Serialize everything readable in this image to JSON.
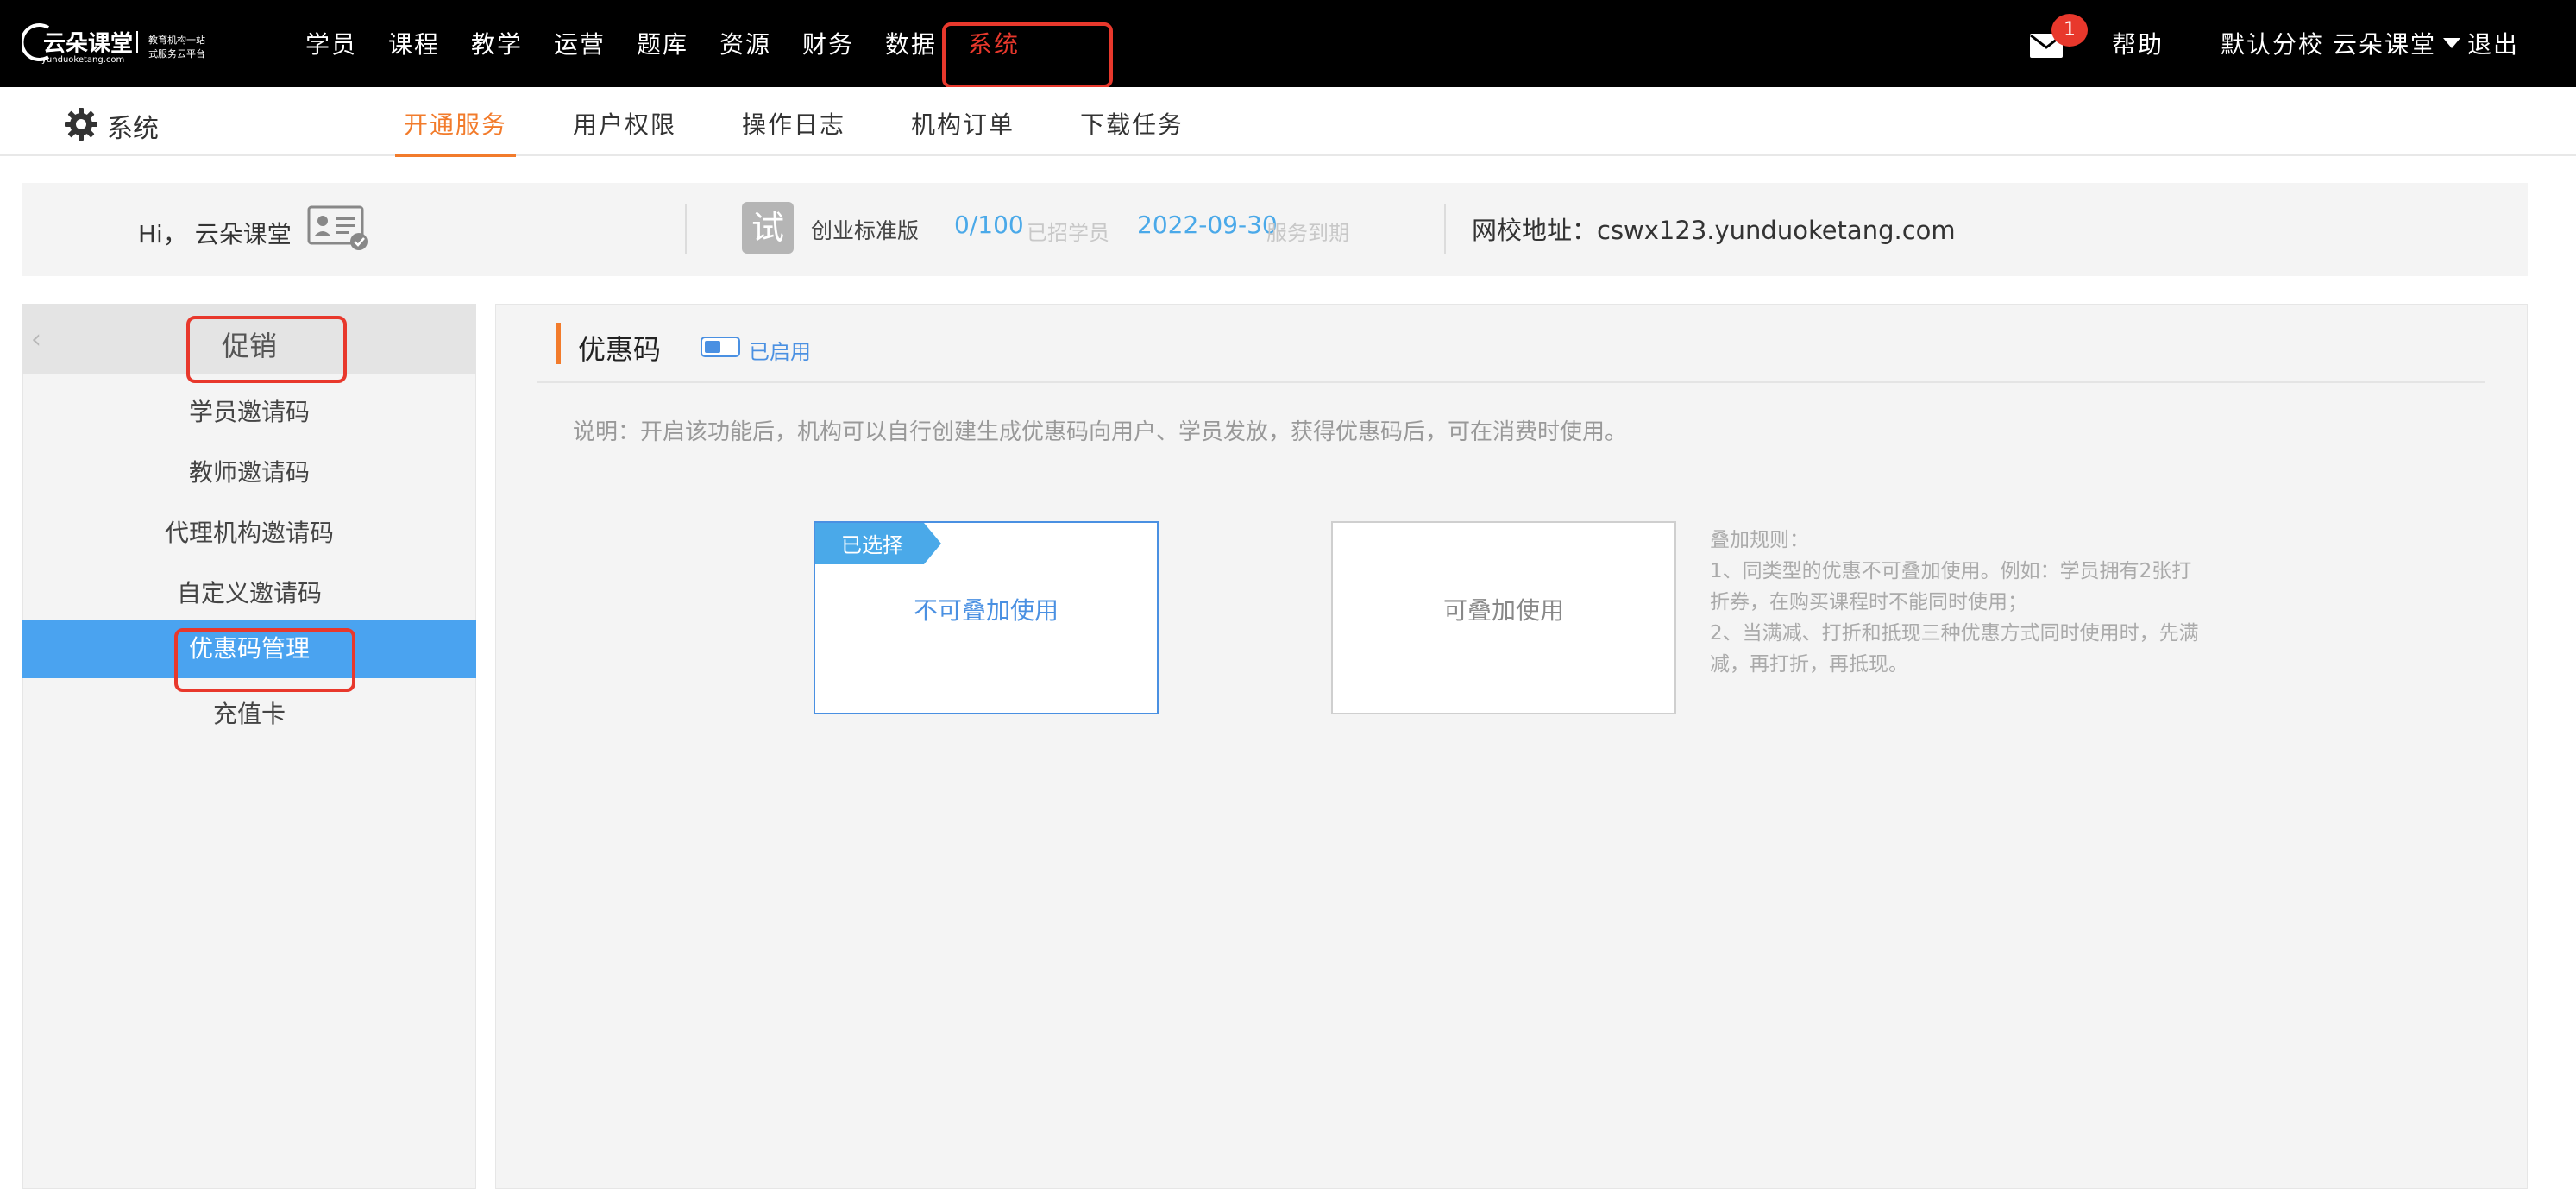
{
  "logo": {
    "main": "云朵课堂",
    "sub": "yunduoketang.com",
    "tag_line1": "教育机构一站",
    "tag_line2": "式服务云平台"
  },
  "top_nav": {
    "items": [
      {
        "label": "学员"
      },
      {
        "label": "课程"
      },
      {
        "label": "教学"
      },
      {
        "label": "运营"
      },
      {
        "label": "题库"
      },
      {
        "label": "资源"
      },
      {
        "label": "财务"
      },
      {
        "label": "数据"
      },
      {
        "label": "系统"
      }
    ],
    "active_index": 8,
    "message_count": "1",
    "help": "帮助",
    "branch": "默认分校",
    "user": "云朵课堂",
    "logout": "退出"
  },
  "sub_nav": {
    "title": "系统",
    "tabs": [
      {
        "label": "开通服务"
      },
      {
        "label": "用户权限"
      },
      {
        "label": "操作日志"
      },
      {
        "label": "机构订单"
      },
      {
        "label": "下载任务"
      }
    ],
    "active_index": 0
  },
  "info": {
    "greeting": "Hi， 云朵课堂",
    "trial_badge": "试",
    "plan": "创业标准版",
    "students_count": "0/100",
    "students_label": "已招学员",
    "expire_date": "2022-09-30",
    "expire_label": "服务到期",
    "school_url": "网校地址：cswx123.yunduoketang.com"
  },
  "sidebar": {
    "title": "促销",
    "items": [
      {
        "label": "学员邀请码"
      },
      {
        "label": "教师邀请码"
      },
      {
        "label": "代理机构邀请码"
      },
      {
        "label": "自定义邀请码"
      },
      {
        "label": "优惠码管理"
      },
      {
        "label": "充值卡"
      }
    ],
    "active_index": 4
  },
  "content": {
    "title": "优惠码",
    "toggle_label": "已启用",
    "toggle_on": true,
    "description": "说明：开启该功能后，机构可以自行创建生成优惠码向用户、学员发放，获得优惠码后，可在消费时使用。",
    "options": [
      {
        "label": "不可叠加使用",
        "selected": true,
        "tag": "已选择"
      },
      {
        "label": "可叠加使用",
        "selected": false
      }
    ],
    "rules": [
      "叠加规则：",
      "1、同类型的优惠不可叠加使用。例如：学员拥有2张打",
      "折券，在购买课程时不能同时使用；",
      "2、当满减、打折和抵现三种优惠方式同时使用时，先满",
      "减，再打折，再抵现。"
    ]
  },
  "colors": {
    "accent_orange": "#f27b2b",
    "accent_blue": "#4aa3f0",
    "highlight_red": "#e8382c",
    "topbar_bg": "#000000"
  }
}
